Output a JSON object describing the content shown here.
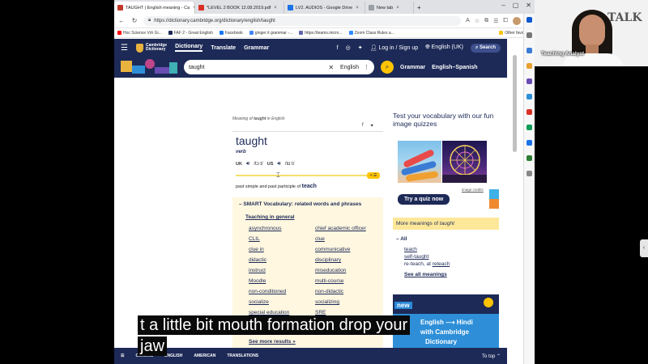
{
  "browser": {
    "tabs": [
      {
        "label": "TAUGHT | English meaning - Ca",
        "color": "#c0392b",
        "active": true
      },
      {
        "label": "*LEVEL 2 BOOK 12.08.2019.pdf",
        "color": "#d93025",
        "active": false
      },
      {
        "label": "LV2. AUDIOS - Google Drive",
        "color": "#1a73e8",
        "active": false
      },
      {
        "label": "New tab",
        "color": "#9aa0a6",
        "active": false
      }
    ],
    "url": "https://dictionary.cambridge.org/dictionary/english/taught",
    "bookmarks": [
      {
        "label": "Hoc Science Với Gi...",
        "color": "#ff0000"
      },
      {
        "label": "FAF 2 - Great English",
        "color": "#1d2a57"
      },
      {
        "label": "Facebook",
        "color": "#1877f2"
      },
      {
        "label": "ginger it grammar -...",
        "color": "#4285f4"
      },
      {
        "label": "https://teams.micro...",
        "color": "#6264a7"
      },
      {
        "label": "Zoom Class Rules a...",
        "color": "#2d8cff"
      },
      {
        "label": "Other favorites",
        "color": "#f5c518"
      }
    ]
  },
  "cd": {
    "logo_line1": "Cambridge",
    "logo_line2": "Dictionary",
    "nav": [
      "Dictionary",
      "Translate",
      "Grammar"
    ],
    "login": "Log in / Sign up",
    "language": "English (UK)",
    "search_btn": "Search",
    "search_query": "taught",
    "search_lang": "English",
    "link_grammar": "Grammar",
    "link_es": "English–Spanish"
  },
  "entry": {
    "meaning_prefix": "Meaning of",
    "meaning_word": "taught",
    "meaning_suffix": "in English",
    "headword": "taught",
    "pos": "verb",
    "uk_label": "UK",
    "uk_ipa": "/tɔːt/",
    "us_label": "US",
    "us_ipa": "/tɑːt/",
    "audio_btn": "+ ☰",
    "def_prefix": "past simple and past participle of",
    "def_word": "teach"
  },
  "smart": {
    "title": "SMART Vocabulary: related words and phrases",
    "subtitle": "Teaching in general",
    "col1": [
      "asynchronous",
      "CLIL",
      "clue in",
      "didactic",
      "instruct",
      "Moodle",
      "non-conditioned",
      "socialize",
      "special education"
    ],
    "col2": [
      "chief academic officer",
      "clue",
      "communicative",
      "disciplinary",
      "miseducation",
      "multi-course",
      "non-didactic",
      "socializing",
      "SRE"
    ],
    "see_more": "See more results »"
  },
  "quiz": {
    "title": "Test your vocabulary with our fun image quizzes",
    "button": "Try a quiz now",
    "credits": "image credits"
  },
  "more": {
    "header_prefix": "More meanings of",
    "header_word": "taught",
    "all": "All",
    "links": [
      "teach",
      "self-taught"
    ],
    "reteach_prefix": "re-teach, at",
    "reteach_link": "reteach",
    "see_all": "See all meanings"
  },
  "ad": {
    "new": "new",
    "line1": "English ⟶ Hindi",
    "line2": "with Cambridge",
    "line3": "Dictionary"
  },
  "footer": {
    "items": [
      "Contents",
      "ENGLISH",
      "AMERICAN",
      "TRANSLATIONS"
    ],
    "to_top": "To top"
  },
  "caption": {
    "line1": "t a little bit mouth formation drop your",
    "line2": "jaw"
  },
  "cam": {
    "name": "Teaching Analyst",
    "bg_text": "TALK"
  }
}
